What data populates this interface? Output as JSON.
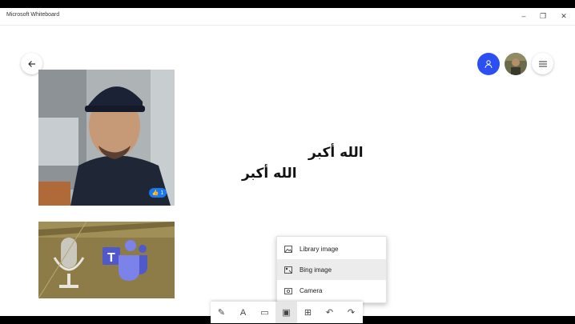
{
  "window": {
    "title": "Microsoft Whiteboard",
    "minimize": "–",
    "maximize": "❐",
    "close": "✕"
  },
  "header": {
    "back_icon": "back-arrow-icon",
    "person_icon": "person-icon",
    "menu_icon": "hamburger-menu-icon"
  },
  "canvas": {
    "texts": [
      "الله أكبر",
      "الله أكبر"
    ],
    "photo_reaction_count": "1"
  },
  "insert_menu": {
    "items": [
      {
        "label": "Library image",
        "icon": "library-image-icon",
        "selected": false
      },
      {
        "label": "Bing image",
        "icon": "bing-image-icon",
        "selected": true
      },
      {
        "label": "Camera",
        "icon": "camera-icon",
        "selected": false
      }
    ]
  },
  "toolbar": {
    "tools": [
      {
        "name": "pen-tool",
        "glyph": "✎"
      },
      {
        "name": "text-tool",
        "glyph": "A"
      },
      {
        "name": "note-tool",
        "glyph": "▭"
      },
      {
        "name": "image-tool",
        "glyph": "▣",
        "active": true
      },
      {
        "name": "insert-tool",
        "glyph": "⊞"
      },
      {
        "name": "undo-tool",
        "glyph": "↶"
      },
      {
        "name": "redo-tool",
        "glyph": "↷"
      }
    ]
  },
  "colors": {
    "accent": "#2b4ff0",
    "like_badge": "#1877f2",
    "selected_item": "#ececec"
  }
}
